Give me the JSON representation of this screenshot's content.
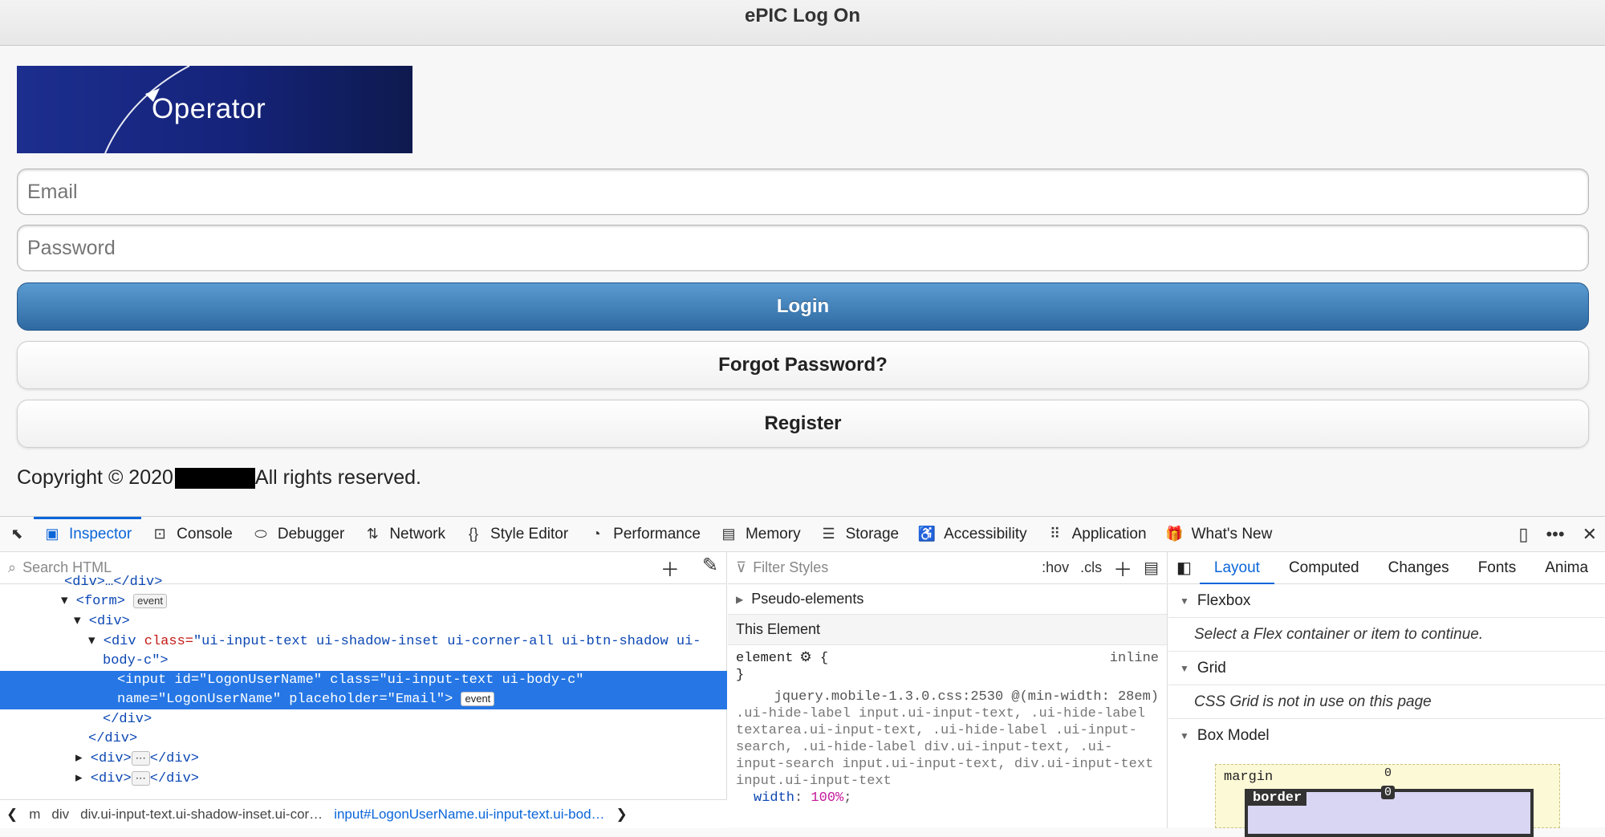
{
  "window": {
    "title": "ePIC Log On"
  },
  "logo": {
    "text": "Operator"
  },
  "form": {
    "email_placeholder": "Email",
    "password_placeholder": "Password",
    "login_label": "Login",
    "forgot_label": "Forgot Password?",
    "register_label": "Register"
  },
  "footer": {
    "copyright_prefix": "Copyright © 2020",
    "copyright_suffix": "All rights reserved."
  },
  "devtools": {
    "tabs": [
      {
        "label": "Inspector",
        "icon": "inspector-icon"
      },
      {
        "label": "Console",
        "icon": "console-icon"
      },
      {
        "label": "Debugger",
        "icon": "debugger-icon"
      },
      {
        "label": "Network",
        "icon": "network-icon"
      },
      {
        "label": "Style Editor",
        "icon": "style-editor-icon"
      },
      {
        "label": "Performance",
        "icon": "performance-icon"
      },
      {
        "label": "Memory",
        "icon": "memory-icon"
      },
      {
        "label": "Storage",
        "icon": "storage-icon"
      },
      {
        "label": "Accessibility",
        "icon": "accessibility-icon"
      },
      {
        "label": "Application",
        "icon": "application-icon"
      },
      {
        "label": "What's New",
        "icon": "gift-icon"
      }
    ],
    "search_html_placeholder": "Search HTML",
    "filter_styles_placeholder": "Filter Styles",
    "hov_label": ":hov",
    "cls_label": ".cls",
    "tree": {
      "row0": "<div>…</div>",
      "form_tag": "<form>",
      "event": "event",
      "div_open": "<div>",
      "div_class_open": "<div ",
      "class_attr": "class=",
      "class_val": "\"ui-input-text ui-shadow-inset ui-corner-all ui-btn-shadow ui-",
      "class_val2": "body-c\">",
      "sel_line1": "<input id=\"LogonUserName\" class=\"ui-input-text ui-body-c\"",
      "sel_line2": "name=\"LogonUserName\" placeholder=\"Email\">",
      "div_close": "</div>",
      "collapsed1": "<div>",
      "collapsed_close": "</div>"
    },
    "breadcrumbs": [
      "m",
      "div",
      "div.ui-input-text.ui-shadow-inset.ui-cor…",
      "input#LogonUserName.ui-input-text.ui-bod…"
    ],
    "rules": {
      "pseudo": "Pseudo-elements",
      "this_element": "This Element",
      "element_sel": "element",
      "inline": "inline",
      "source": "jquery.mobile-1.3.0.css:2530 @(min-width: 28em)",
      "selector_text": ".ui-hide-label input.ui-input-text, .ui-hide-label textarea.ui-input-text, .ui-hide-label .ui-input-search, .ui-hide-label div.ui-input-text, .ui-input-search input.ui-input-text, div.ui-input-text input.ui-input-text",
      "prop": "width",
      "value": "100%"
    },
    "side_tabs": [
      "Layout",
      "Computed",
      "Changes",
      "Fonts",
      "Anima"
    ],
    "flexbox_title": "Flexbox",
    "flexbox_msg": "Select a Flex container or item to continue.",
    "grid_title": "Grid",
    "grid_msg": "CSS Grid is not in use on this page",
    "boxmodel_title": "Box Model",
    "margin_label": "margin",
    "border_label": "border",
    "zero": "0"
  },
  "colors": {
    "accent": "#0a65d9",
    "login": "#3a7bb5",
    "selection": "#2677e5"
  }
}
